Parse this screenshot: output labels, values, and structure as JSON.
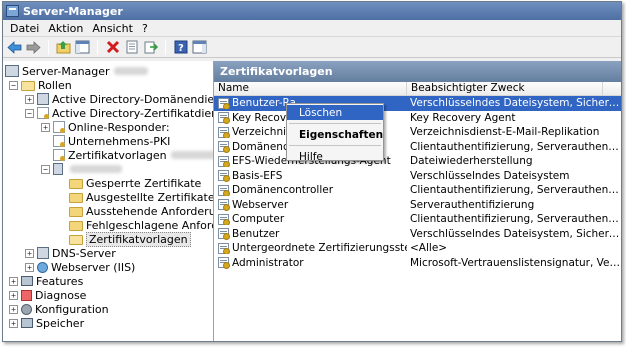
{
  "window": {
    "title": "Server-Manager"
  },
  "menu": [
    "Datei",
    "Aktion",
    "Ansicht",
    "?"
  ],
  "tree": {
    "root": "Server-Manager",
    "roles": "Rollen",
    "ad_domain": "Active Directory-Domänendienste",
    "ad_cert": "Active Directory-Zertifikatdienste",
    "online_responder": "Online-Responder:",
    "enterprise_pki": "Unternehmens-PKI",
    "cert_templates_node": "Zertifikatvorlagen",
    "ca_folders": [
      "Gesperrte Zertifikate",
      "Ausgestellte Zertifikate",
      "Ausstehende Anforderungen",
      "Fehlgeschlagene Anforderungen",
      "Zertifikatvorlagen"
    ],
    "dns": "DNS-Server",
    "iis": "Webserver (IIS)",
    "features": "Features",
    "diagnose": "Diagnose",
    "config": "Konfiguration",
    "storage": "Speicher"
  },
  "panel": {
    "title": "Zertifikatvorlagen",
    "columns": [
      "Name",
      "Beabsichtigter Zweck"
    ],
    "rows": [
      {
        "name": "Benutzer-Ra",
        "purpose": "Verschlüsselndes Dateisystem, Sichere E-M..."
      },
      {
        "name": "Key Recove",
        "purpose": "Key Recovery Agent"
      },
      {
        "name": "Verzeichnis",
        "purpose": "Verzeichnisdienst-E-Mail-Replikation"
      },
      {
        "name": "Domänencon",
        "purpose": "Clientauthentifizierung, Serverauthentifizie..."
      },
      {
        "name": "EFS-Wiederherstellungs-Agent",
        "purpose": "Dateiwiederherstellung"
      },
      {
        "name": "Basis-EFS",
        "purpose": "Verschlüsselndes Dateisystem"
      },
      {
        "name": "Domänencontroller",
        "purpose": "Clientauthentifizierung, Serverauthentifizie..."
      },
      {
        "name": "Webserver",
        "purpose": "Serverauthentifizierung"
      },
      {
        "name": "Computer",
        "purpose": "Clientauthentifizierung, Serverauthentifizie..."
      },
      {
        "name": "Benutzer",
        "purpose": "Verschlüsselndes Dateisystem, Sichere E-M..."
      },
      {
        "name": "Untergeordnete Zertifizierungsstelle",
        "purpose": "<Alle>"
      },
      {
        "name": "Administrator",
        "purpose": "Microsoft-Vertrauenslistensignatur, Verschl..."
      }
    ]
  },
  "context_menu": {
    "delete": "Löschen",
    "properties": "Eigenschaften",
    "help": "Hilfe"
  },
  "colors": {
    "selection": "#3165c4",
    "header": "#647e9f"
  }
}
